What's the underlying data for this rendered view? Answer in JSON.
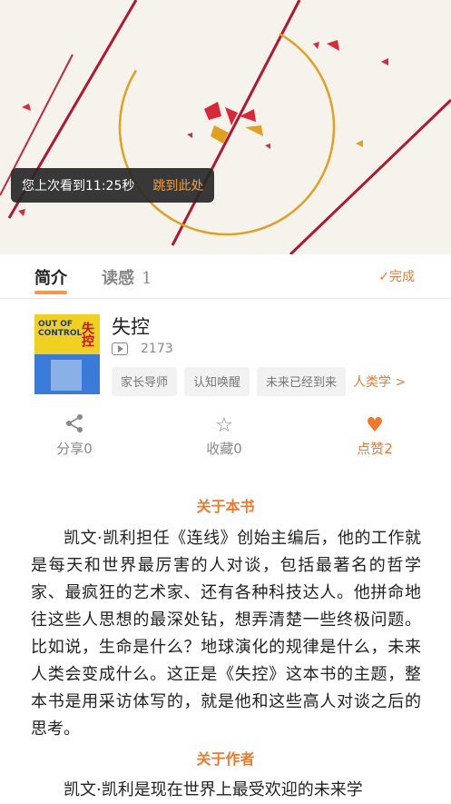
{
  "resume": {
    "text": "您上次看到11:25秒",
    "jump": "跳到此处"
  },
  "tabs": {
    "intro": "简介",
    "review": "读感",
    "review_count": "1",
    "done": "✓完成"
  },
  "book": {
    "title": "失控",
    "plays": "2173",
    "cover_title": "OUT OF CONTROL",
    "cover_title_cn": "失控",
    "tags": [
      "家长导师",
      "认知唤醒",
      "未来已经到来"
    ],
    "category": "人类学 >"
  },
  "actions": {
    "share": "分享0",
    "favorite": "收藏0",
    "like": "点赞2"
  },
  "about_book": {
    "heading": "关于本书",
    "text": "凯文·凯利担任《连线》创始主编后，他的工作就是每天和世界最厉害的人对谈，包括最著名的哲学家、最疯狂的艺术家、还有各种科技达人。他拼命地往这些人思想的最深处钻，想弄清楚一些终极问题。比如说，生命是什么？地球演化的规律是什么，未来人类会变成什么。这正是《失控》这本书的主题，整本书是用采访体写的，就是他和这些高人对谈之后的思考。"
  },
  "about_author": {
    "heading": "关于作者",
    "text": "凯文·凯利是现在世界上最受欢迎的未来学"
  },
  "colors": {
    "accent": "#f07828",
    "hero_bg": "#f6f2ec",
    "ring": "#e0a020",
    "shards": "#d8283a"
  }
}
